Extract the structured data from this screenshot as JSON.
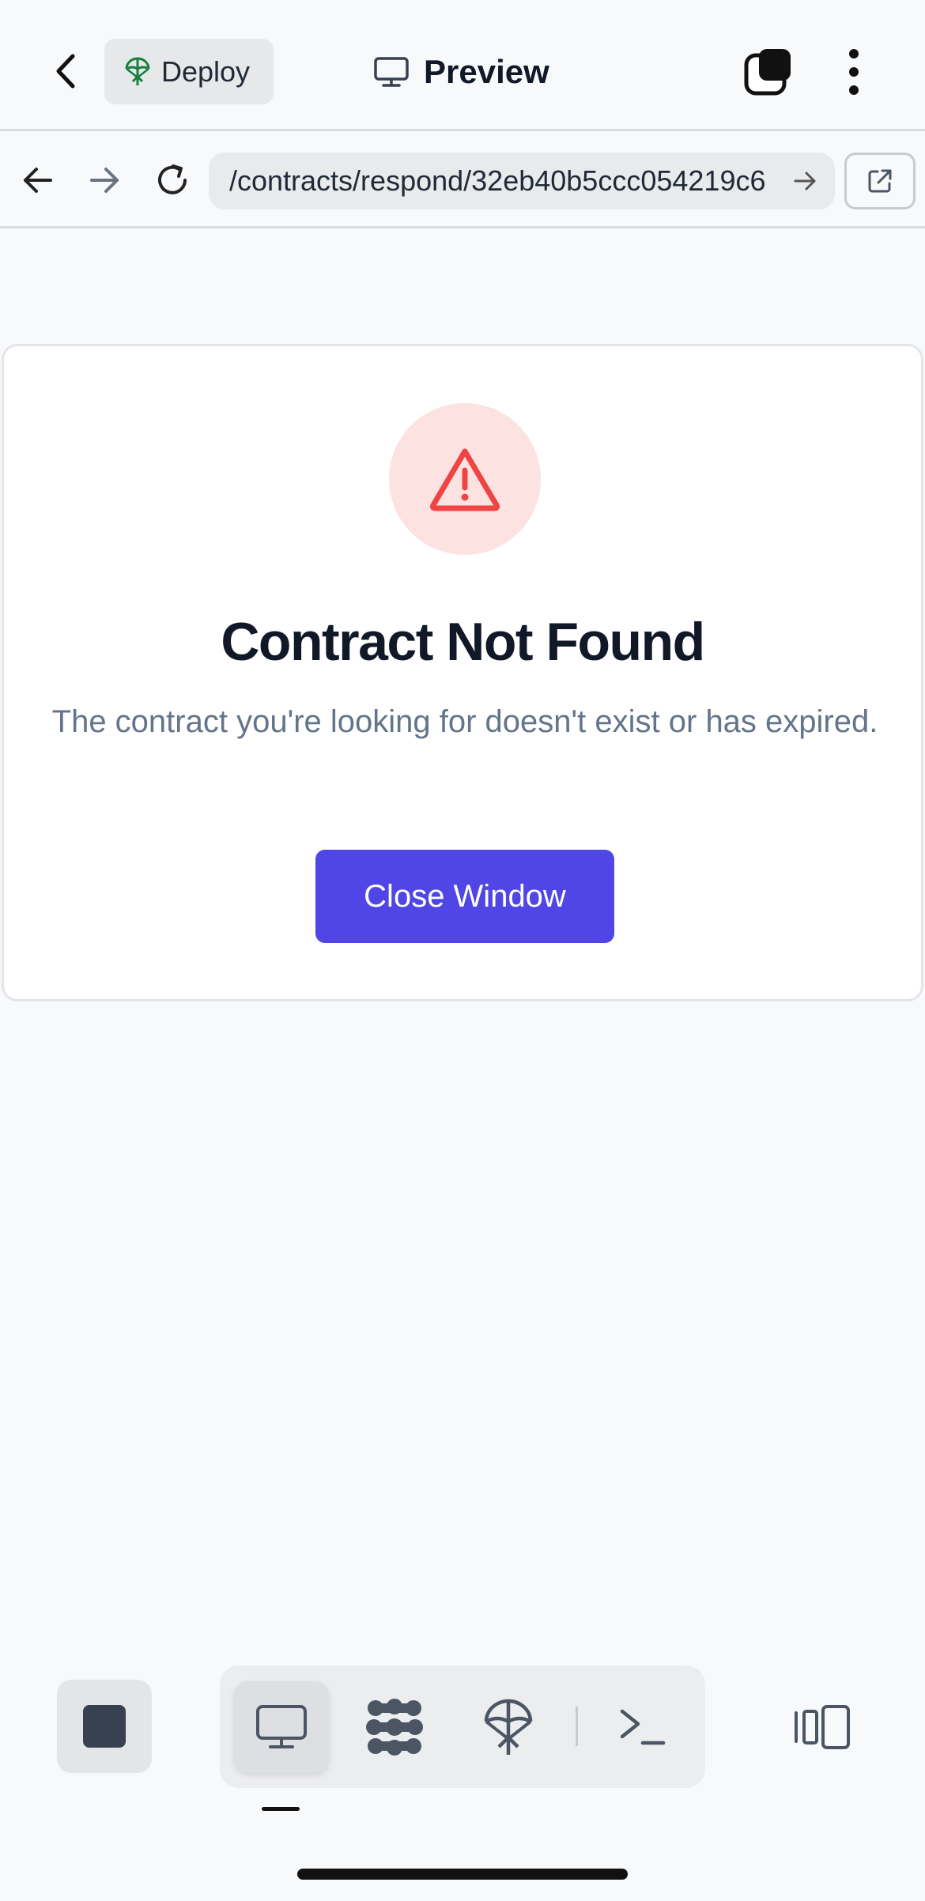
{
  "app_bar": {
    "back_icon": "chevron-left-icon",
    "deploy_label": "Deploy",
    "deploy_icon": "deploy-parachute-icon",
    "preview_label": "Preview",
    "preview_icon": "monitor-icon",
    "tabs_icon": "tabs-icon",
    "menu_icon": "kebab-menu-icon"
  },
  "browser": {
    "url": "/contracts/respond/32eb40b5ccc054219c6",
    "back_icon": "arrow-left-icon",
    "forward_icon": "arrow-right-icon",
    "reload_icon": "reload-icon",
    "go_icon": "arrow-right-icon",
    "open_external_icon": "external-link-icon"
  },
  "card": {
    "icon": "warning-triangle-icon",
    "title": "Contract Not Found",
    "message": "The contract you're looking for doesn't exist or has expired.",
    "button_label": "Close Window"
  },
  "bottom_toolbar": {
    "stop_icon": "stop-icon",
    "modes": [
      {
        "icon": "monitor-icon",
        "active": true
      },
      {
        "icon": "workflow-icon",
        "active": false
      },
      {
        "icon": "deploy-parachute-icon",
        "active": false
      },
      {
        "icon": "terminal-icon",
        "active": false
      }
    ],
    "layout_icon": "split-layout-icon"
  },
  "colors": {
    "accent": "#4f46e5",
    "danger": "#ef4444",
    "danger_bg": "#fde2e2",
    "deploy_green": "#15803d",
    "text_primary": "#111827",
    "text_muted": "#64748b",
    "background": "#f8f9fb"
  }
}
